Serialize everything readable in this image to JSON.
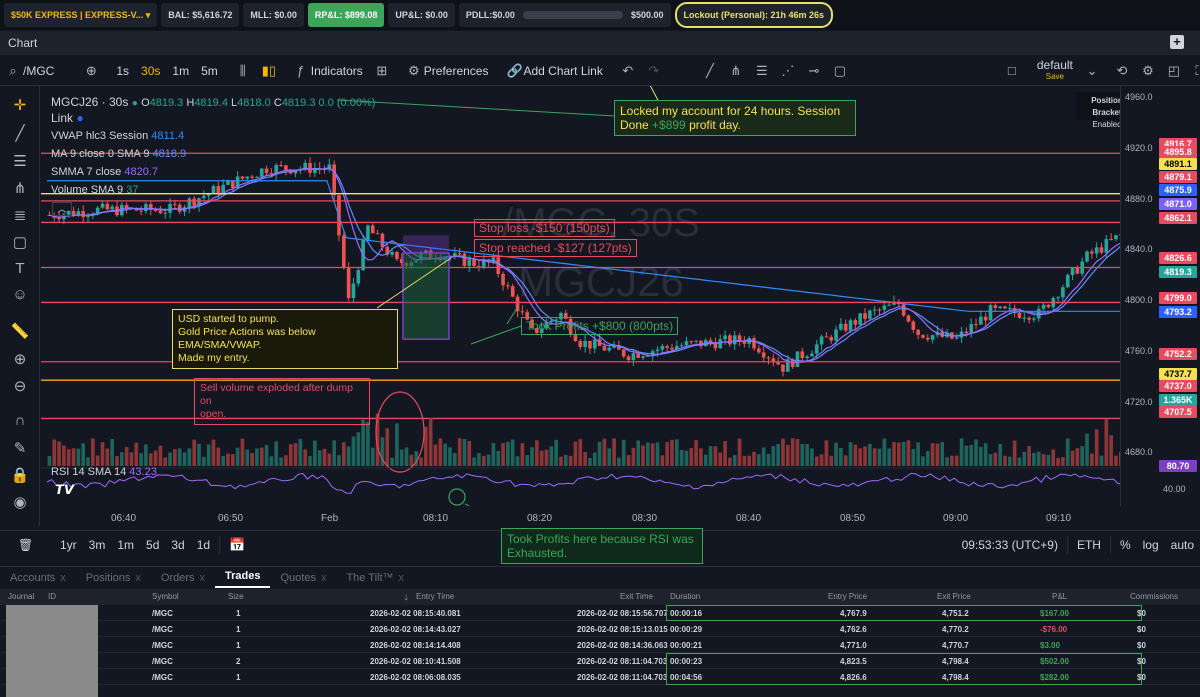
{
  "topbar": {
    "account": "$50K EXPRESS | EXPRESS-V...",
    "bal": "BAL: $5,616.72",
    "mll": "MLL: $0.00",
    "rpl": "RP&L: $899.08",
    "upl": "UP&L: $0.00",
    "pdll": "PDLL:$0.00",
    "pdll_limit": "$500.00",
    "lockout": "Lockout (Personal): 21h 46m 26s"
  },
  "chart_header": {
    "title": "Chart"
  },
  "toolbar": {
    "symbol": "/MGC",
    "intervals": [
      "1s",
      "30s",
      "1m",
      "5m"
    ],
    "active_interval": "30s",
    "indicators": "Indicators",
    "preferences": "Preferences",
    "add_link": "Add Chart Link",
    "layout_name": "default",
    "layout_save": "Save"
  },
  "legend": {
    "symbol": "MGCJ26 · 30s",
    "ohlc": {
      "o": "4819.3",
      "h": "4819.4",
      "l": "4818.0",
      "c": "4819.3",
      "chg": "0.0 (0.00%)"
    },
    "link": "Link",
    "vwap": "VWAP hlc3 Session",
    "vwap_val": "4811.4",
    "ma": "MA 9 close 0 SMA 9",
    "ma_val": "4818.9",
    "sma": "SMMA 7 close",
    "sma_val": "4820.7",
    "volume": "Volume SMA 9",
    "volume_val": "37",
    "rsi": "RSI 14 SMA 14",
    "rsi_val": "43.23"
  },
  "watermark": {
    "line1": "/MGC, 30S",
    "line2": "MGCJ26"
  },
  "position_bracket": {
    "title": "Position Bracket",
    "state": "Enabled"
  },
  "annotations": {
    "locked": [
      "Locked my account for 24 hours. Session",
      "Done ",
      "+$899",
      " profit day."
    ],
    "stop_loss": "Stop loss -$150 (150pts)",
    "stop_reached": "Stop reached -$127 (127pts)",
    "usd_pump": [
      "USD started to pump.",
      "Gold Price Actions was below EMA/SMA/VWAP.",
      "Made my entry."
    ],
    "took_profits": "Took Profits +$800 (800pts)",
    "sell_volume": [
      "Sell volume exploded after dump on",
      "open."
    ],
    "rsi_note": [
      "Took Profits here because RSI was",
      "Exhausted."
    ]
  },
  "chart_data": {
    "type": "candlestick",
    "ylim": [
      4670,
      4965
    ],
    "yticks": [
      4960.0,
      4920.0,
      4880.0,
      4840.0,
      4800.0,
      4760.0,
      4720.0,
      4680.0
    ],
    "xticks": [
      "06:40",
      "06:50",
      "Feb",
      "08:10",
      "08:20",
      "08:30",
      "08:40",
      "08:50",
      "09:00",
      "09:10"
    ],
    "levels": [
      {
        "label": "4916.7",
        "color": "#e84a5f"
      },
      {
        "label": "4895.8",
        "color": "#e84a5f"
      },
      {
        "label": "4891.1",
        "color": "#f5e050"
      },
      {
        "label": "4879.1",
        "color": "#e84a5f"
      },
      {
        "label": "4875.9",
        "color": "#2962ff"
      },
      {
        "label": "4871.0",
        "color": "#7b61ff"
      },
      {
        "label": "4862.1",
        "color": "#e84a5f"
      },
      {
        "label": "4826.6",
        "color": "#e84a5f"
      },
      {
        "label": "4819.3",
        "color": "#26a69a"
      },
      {
        "label": "4799.0",
        "color": "#e84a5f"
      },
      {
        "label": "4793.2",
        "color": "#2962ff"
      },
      {
        "label": "4752.2",
        "color": "#e84a5f"
      },
      {
        "label": "4737.7",
        "color": "#f5e050"
      },
      {
        "label": "4737.0",
        "color": "#e84a5f"
      },
      {
        "label": "1.365K",
        "color": "#26a69a"
      },
      {
        "label": "4707.5",
        "color": "#e84a5f"
      }
    ],
    "hlines": [
      4916.7,
      4879.1,
      4862.1,
      4826.6,
      4799.0,
      4752.2,
      4737.7,
      4707.5
    ],
    "rsi_ticks": [
      "80.70",
      "40.00"
    ]
  },
  "rangebar": {
    "ranges": [
      "1yr",
      "3m",
      "1m",
      "5d",
      "3d",
      "1d"
    ],
    "clock": "09:53:33 (UTC+9)",
    "session": "ETH",
    "pct": "%",
    "log": "log",
    "auto": "auto"
  },
  "panel": {
    "tabs": [
      "Accounts",
      "Positions",
      "Orders",
      "Trades",
      "Quotes",
      "The Tilt™"
    ],
    "active_tab": "Trades",
    "columns": [
      "Journal",
      "ID",
      "Symbol",
      "Size",
      "Entry Time",
      "Exit Time",
      "Duration",
      "Entry Price",
      "Exit Price",
      "P&L",
      "Commissions"
    ],
    "rows": [
      {
        "symbol": "/MGC",
        "size": "1",
        "entry_time": "2026-02-02 08:15:40.081",
        "exit_time": "2026-02-02 08:15:56.707",
        "duration": "00:00:16",
        "entry_price": "4,767.9",
        "exit_price": "4,751.2",
        "pnl": "$167.00",
        "pnl_color": "#3ba559",
        "comm": "$0"
      },
      {
        "symbol": "/MGC",
        "size": "1",
        "entry_time": "2026-02-02 08:14:43.027",
        "exit_time": "2026-02-02 08:15:13.015",
        "duration": "00:00:29",
        "entry_price": "4,762.6",
        "exit_price": "4,770.2",
        "pnl": "-$76.00",
        "pnl_color": "#e84a5f",
        "comm": "$0"
      },
      {
        "symbol": "/MGC",
        "size": "1",
        "entry_time": "2026-02-02 08:14:14.408",
        "exit_time": "2026-02-02 08:14:36.063",
        "duration": "00:00:21",
        "entry_price": "4,771.0",
        "exit_price": "4,770.7",
        "pnl": "$3.00",
        "pnl_color": "#3ba559",
        "comm": "$0"
      },
      {
        "symbol": "/MGC",
        "size": "2",
        "entry_time": "2026-02-02 08:10:41.508",
        "exit_time": "2026-02-02 08:11:04.703",
        "duration": "00:00:23",
        "entry_price": "4,823.5",
        "exit_price": "4,798.4",
        "pnl": "$502.00",
        "pnl_color": "#3ba559",
        "comm": "$0"
      },
      {
        "symbol": "/MGC",
        "size": "1",
        "entry_time": "2026-02-02 08:06:08.035",
        "exit_time": "2026-02-02 08:11:04.703",
        "duration": "00:04:56",
        "entry_price": "4,826.6",
        "exit_price": "4,798.4",
        "pnl": "$282.00",
        "pnl_color": "#3ba559",
        "comm": "$0"
      }
    ]
  }
}
